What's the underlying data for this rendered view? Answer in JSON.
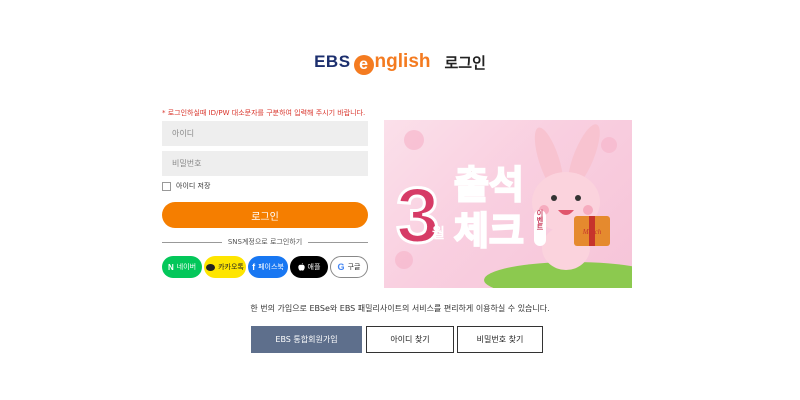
{
  "header": {
    "logo": {
      "ebs": "EBS",
      "e": "e",
      "nglish": "nglish"
    },
    "title": "로그인"
  },
  "form": {
    "notice": "* 로그인하실때 ID/PW 대소문자를 구분하여 입력해 주시기 바랍니다.",
    "id_placeholder": "아이디",
    "pw_placeholder": "비밀번호",
    "save_id_label": "아이디 저장",
    "login_button": "로그인"
  },
  "sns": {
    "divider_text": "SNS계정으로 로그인하기",
    "buttons": [
      {
        "icon": "naver-icon",
        "glyph": "N",
        "label": "네이버"
      },
      {
        "icon": "kakao-icon",
        "glyph": "",
        "label": "카카오톡"
      },
      {
        "icon": "facebook-icon",
        "glyph": "f",
        "label": "페이스북"
      },
      {
        "icon": "apple-icon",
        "glyph": "",
        "label": "애플"
      },
      {
        "icon": "google-icon",
        "glyph": "G",
        "label": "구글"
      }
    ]
  },
  "banner": {
    "line1": "출석",
    "line2": "체크",
    "number": "3",
    "month_suffix": "월",
    "event_tag": "이벤트",
    "gift_label": "March"
  },
  "info_text": "한 번의 가입으로 EBSe와 EBS 패밀리사이트의 서비스를 편리하게 이용하실 수 있습니다.",
  "bottom_buttons": {
    "join": "EBS 통합회원가입",
    "find_id": "아이디 찾기",
    "find_pw": "비밀번호 찾기"
  },
  "colors": {
    "accent_orange": "#f57e00",
    "brand_navy": "#1c2f6e",
    "notice_red": "#d9342b",
    "join_button": "#5e6f8c"
  }
}
